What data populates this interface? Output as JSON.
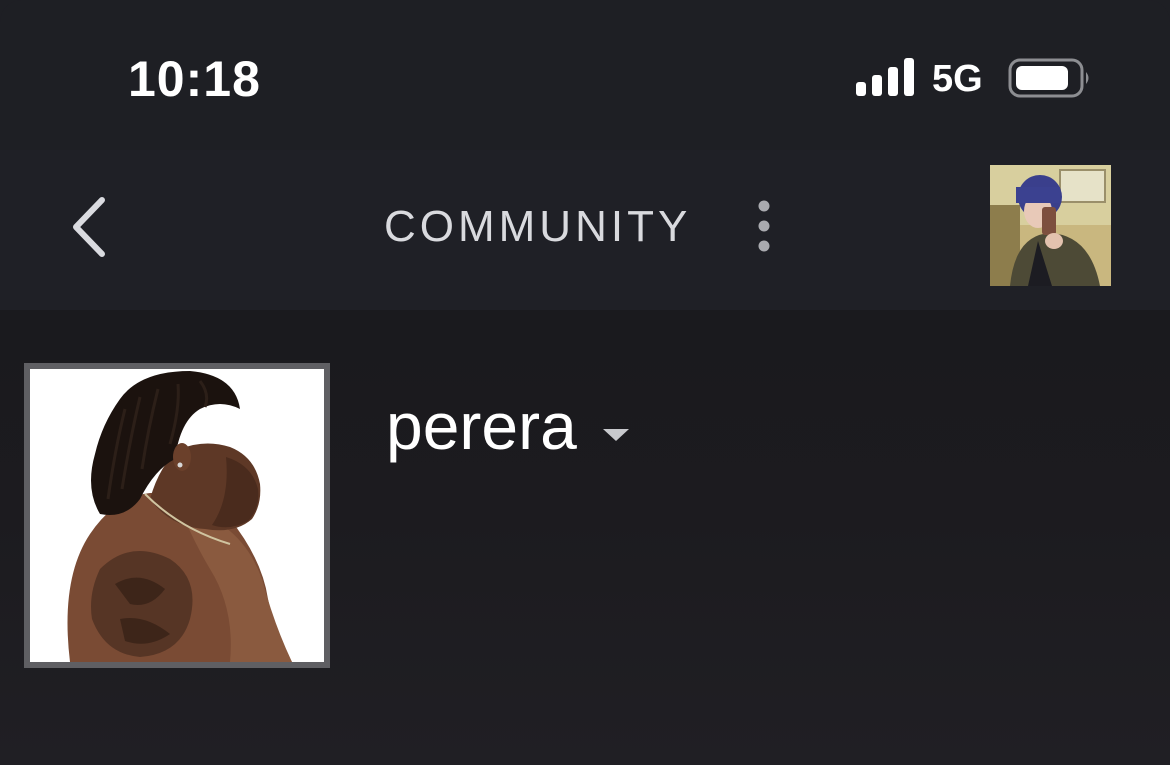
{
  "status_bar": {
    "time": "10:18",
    "network": "5G",
    "signal_icon": "signal-bars-icon",
    "battery_icon": "battery-icon"
  },
  "nav": {
    "back_icon": "chevron-left-icon",
    "title": "COMMUNITY",
    "more_icon": "vertical-ellipsis-icon",
    "avatar_icon": "user-avatar"
  },
  "profile": {
    "username": "perera",
    "dropdown_icon": "caret-down-icon",
    "photo": "profile-photo"
  },
  "colors": {
    "background": "#1e1f24",
    "nav_background": "#1f2026",
    "text_primary": "#ffffff",
    "text_secondary": "#d9dade",
    "frame": "#5f5f63"
  }
}
